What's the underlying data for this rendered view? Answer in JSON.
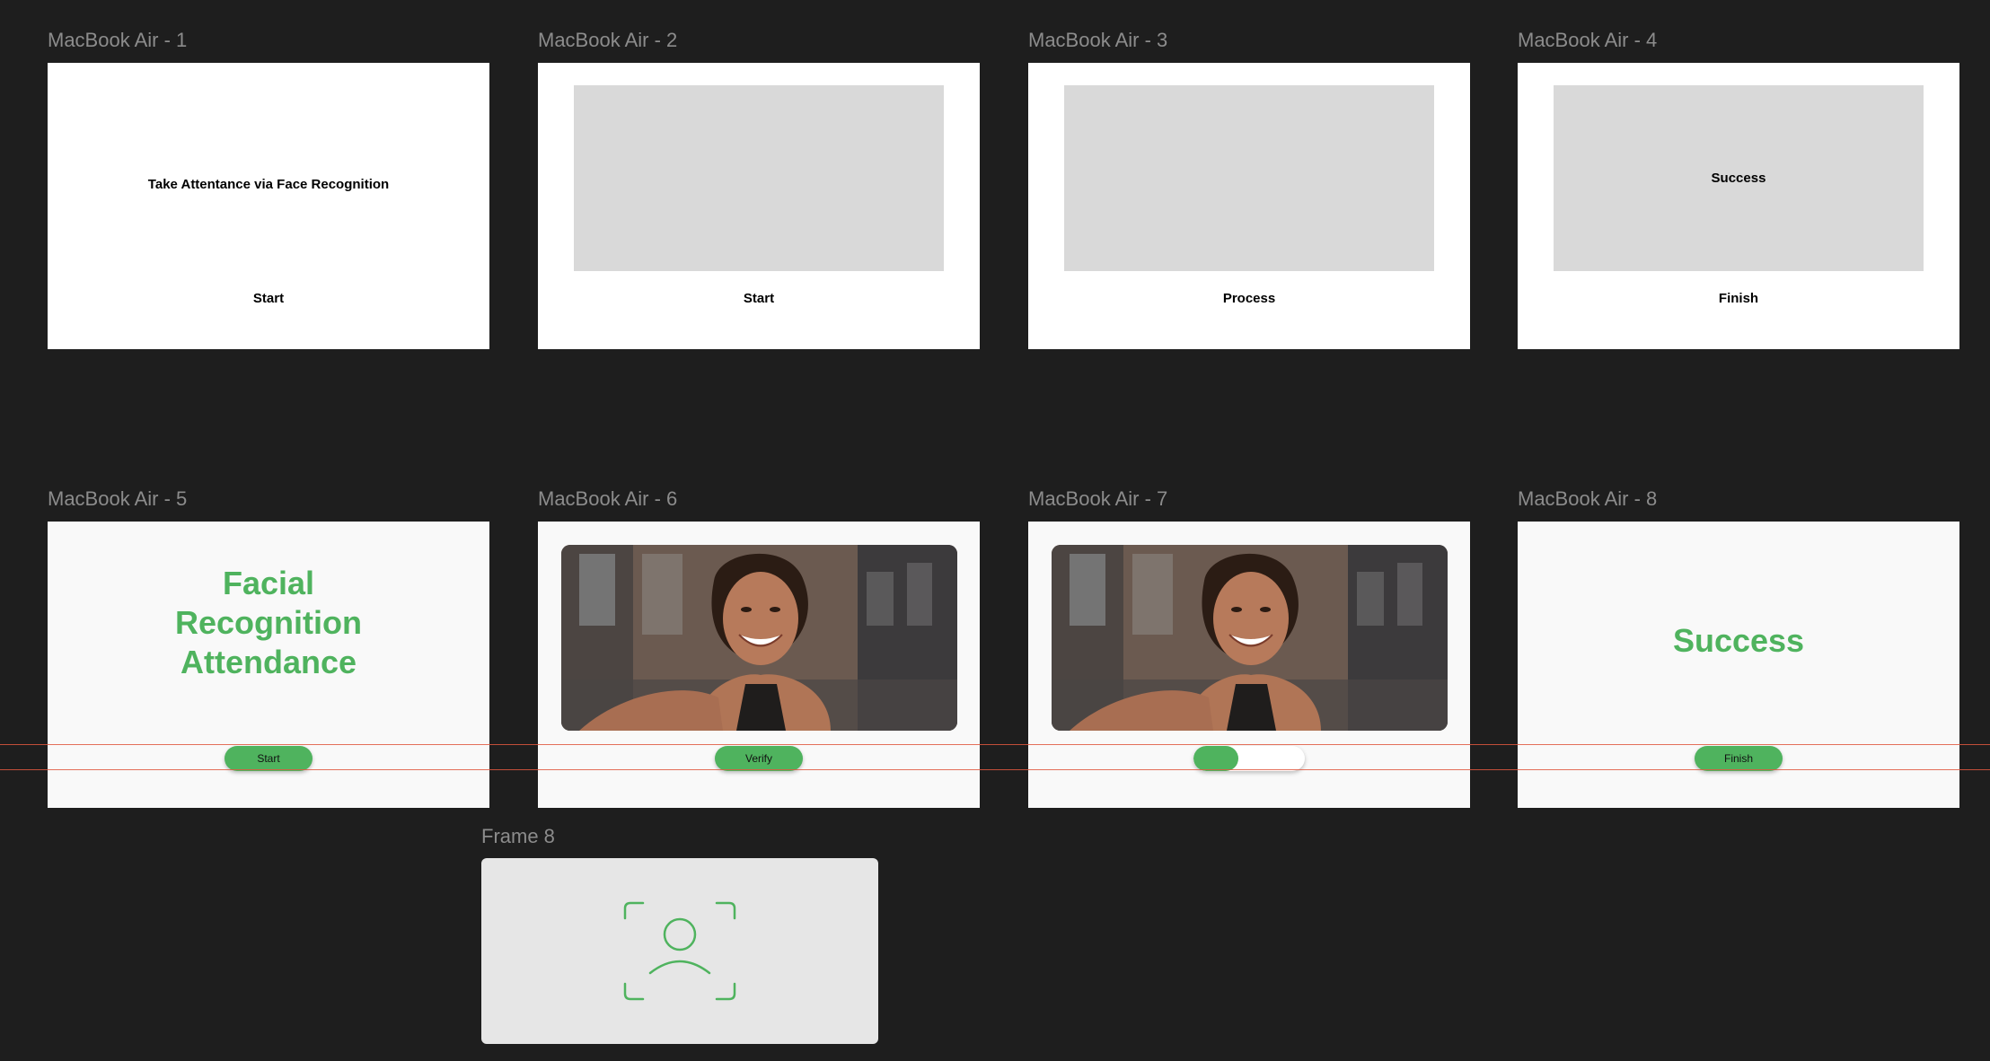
{
  "frames": [
    {
      "label": "MacBook Air - 1",
      "heading": "Take Attentance via Face Recognition",
      "button": "Start"
    },
    {
      "label": "MacBook Air - 2",
      "button": "Start"
    },
    {
      "label": "MacBook Air - 3",
      "button": "Process"
    },
    {
      "label": "MacBook Air - 4",
      "placeholder_text": "Success",
      "button": "Finish"
    },
    {
      "label": "MacBook Air - 5",
      "title_lines": [
        "Facial",
        "Recognition",
        "Attendance"
      ],
      "button": "Start"
    },
    {
      "label": "MacBook Air - 6",
      "button": "Verify"
    },
    {
      "label": "MacBook Air - 7",
      "progress": 0.4
    },
    {
      "label": "MacBook Air - 8",
      "title": "Success",
      "button": "Finish"
    }
  ],
  "frame8": {
    "label": "Frame 8",
    "icon": "face-id-icon"
  },
  "colors": {
    "canvas": "#1e1e1e",
    "accent_green": "#4fb35e",
    "placeholder": "#d9d9d9",
    "guide": "#e0573e"
  }
}
